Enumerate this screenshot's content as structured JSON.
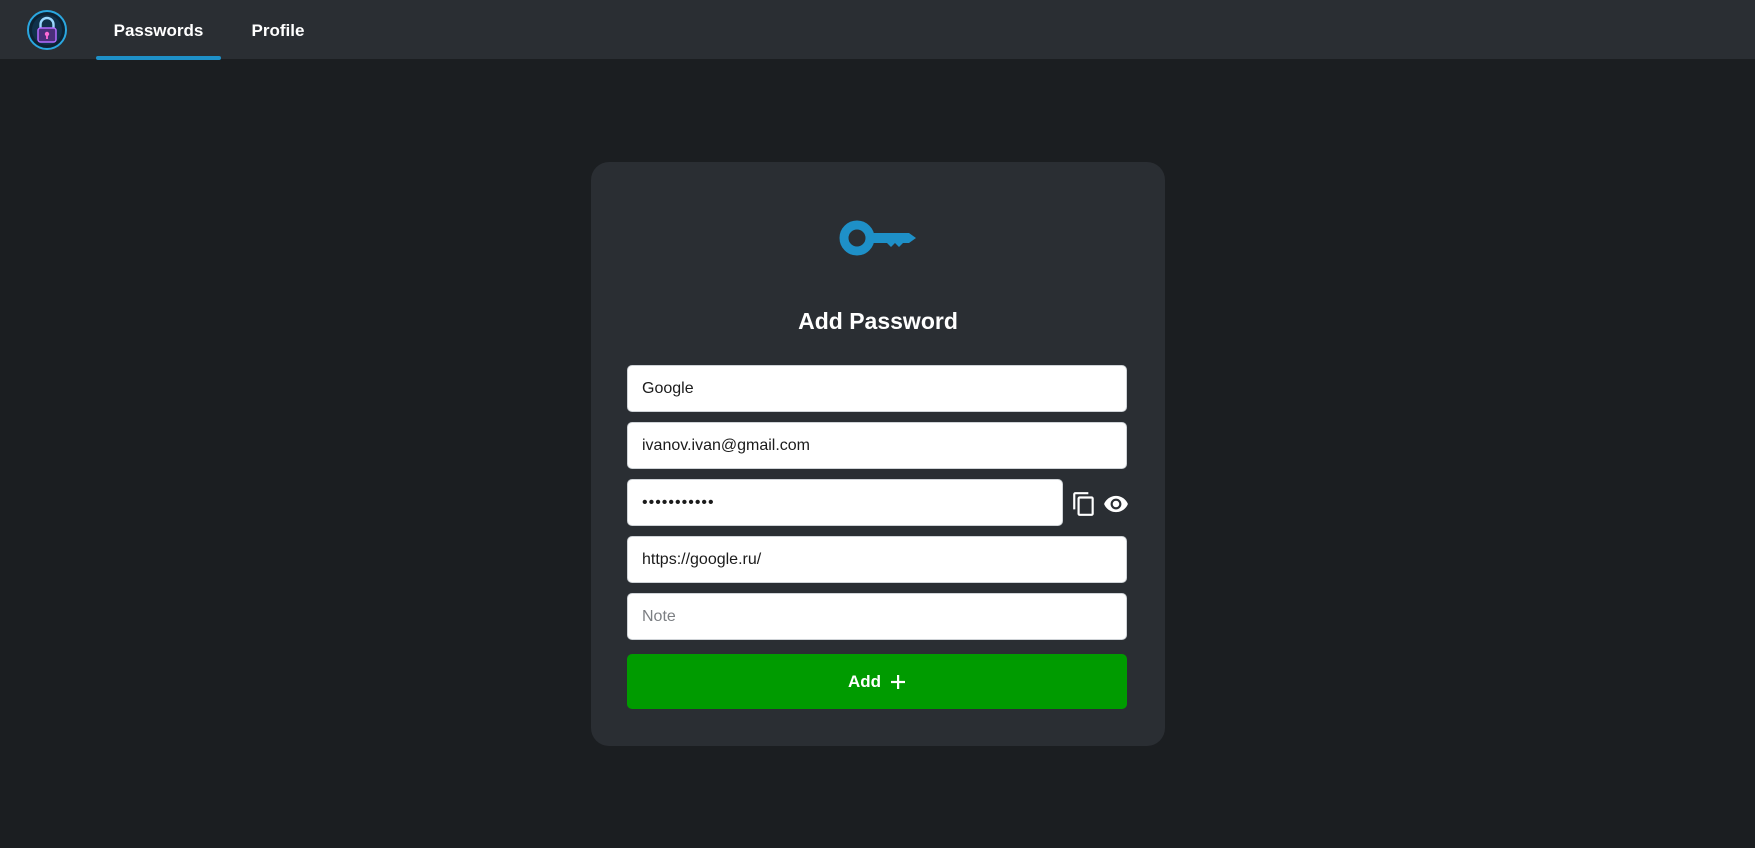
{
  "nav": {
    "logo_icon": "padlock-logo-icon",
    "tabs": [
      {
        "label": "Passwords",
        "active": true
      },
      {
        "label": "Profile",
        "active": false
      }
    ],
    "accent": "#1e90c8"
  },
  "form": {
    "header_icon": "key-icon",
    "title": "Add Password",
    "name_value": "Google",
    "login_value": "ivanov.ivan@gmail.com",
    "password_value": "•••••••••••",
    "url_value": "https://google.ru/",
    "note_placeholder": "Note",
    "copy_icon": "copy-icon",
    "show_icon": "eye-icon",
    "submit_label": "Add",
    "submit_icon": "plus-icon",
    "submit_color": "#009b00"
  }
}
